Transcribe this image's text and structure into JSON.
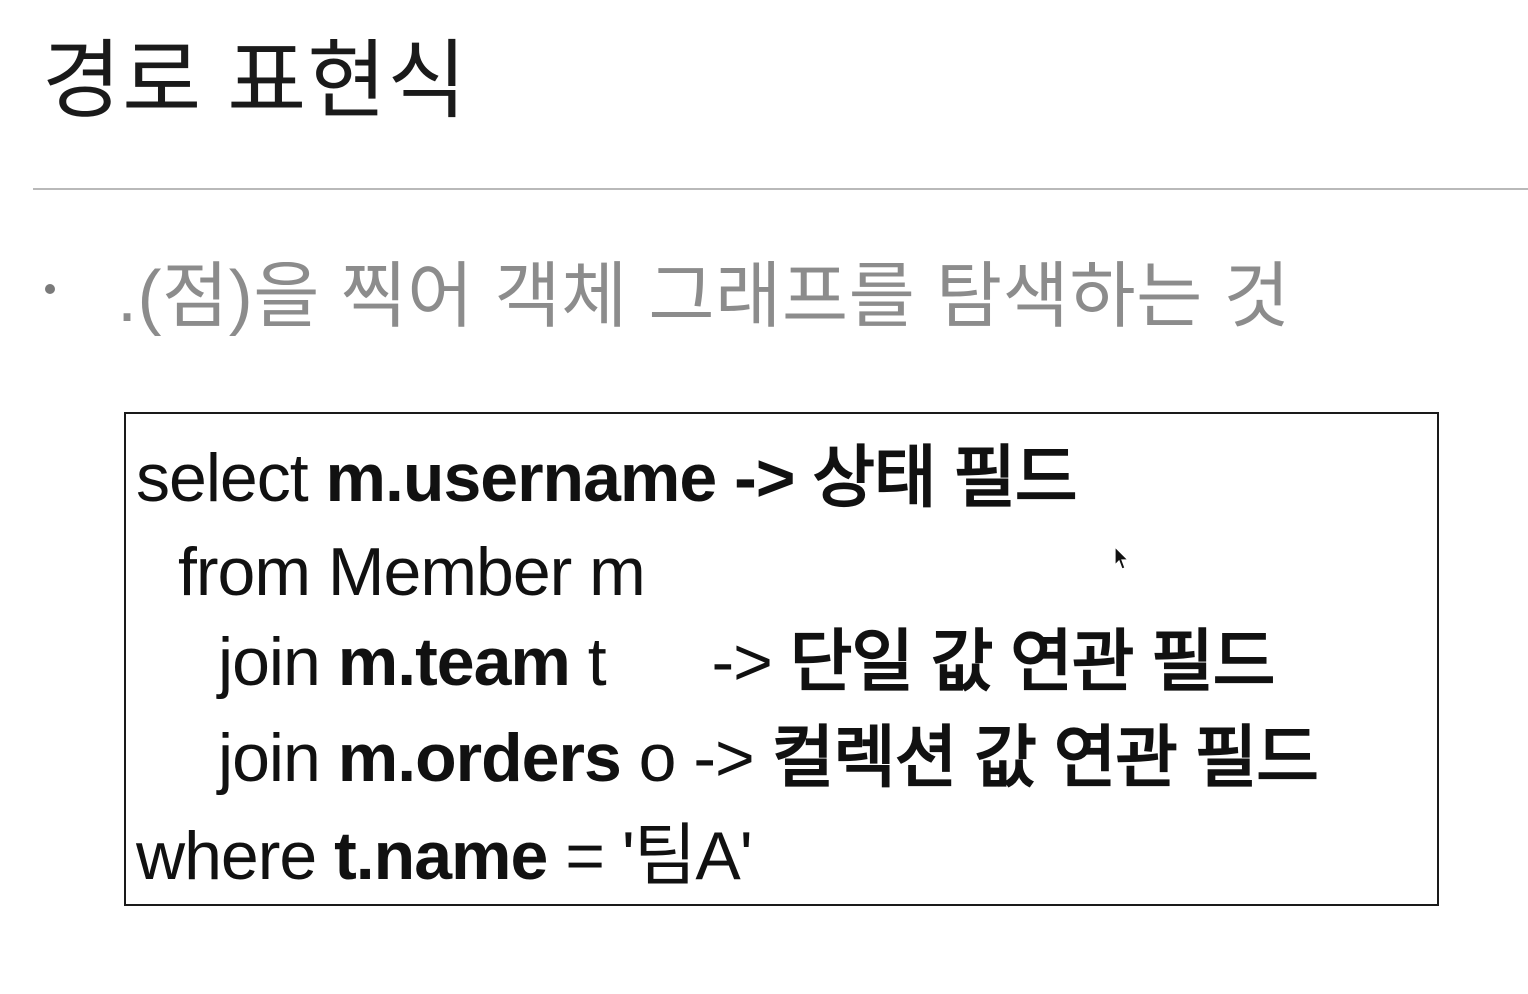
{
  "slide": {
    "title": "경로 표현식",
    "bullet": ".(점)을 찍어 객체 그래프를 탐색하는 것"
  },
  "code": {
    "line1": {
      "kw": "select",
      "field": "m.username",
      "arrow": "->",
      "note": "상태 필드"
    },
    "line2": {
      "text": "from Member m"
    },
    "line3": {
      "kw": "join",
      "field": "m.team",
      "alias": "t",
      "arrow": "->",
      "note": "단일 값 연관 필드"
    },
    "line4": {
      "kw": "join",
      "field": "m.orders",
      "alias": "o",
      "arrow": "->",
      "note": "컬렉션 값 연관 필드"
    },
    "line5": {
      "kw": "where",
      "field": "t.name",
      "op": "=",
      "value": "'팀A'"
    }
  },
  "icons": {
    "cursor": "mouse-pointer-icon"
  }
}
